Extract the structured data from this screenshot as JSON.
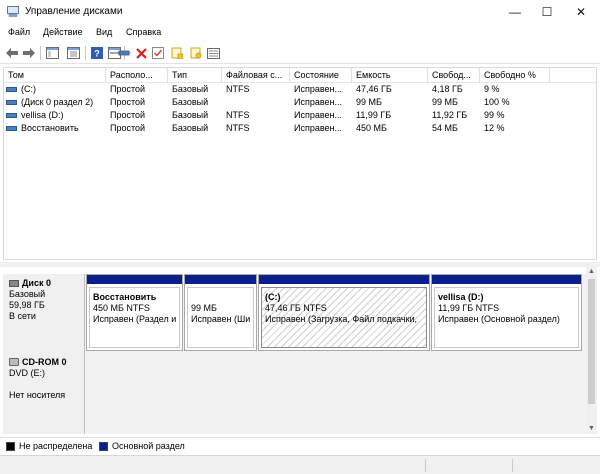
{
  "window": {
    "title": "Управление дисками",
    "minimize": "—",
    "maximize": "☐",
    "close": "✕"
  },
  "menu": [
    "Файл",
    "Действие",
    "Вид",
    "Справка"
  ],
  "toolbar": {
    "buttons": [
      "back-icon",
      "forward-icon",
      "console-tree-icon",
      "help-icon",
      "properties-icon",
      "connect-disk-icon",
      "delete-icon",
      "check-icon",
      "folder-icon",
      "folder-open-icon",
      "view-list-icon"
    ]
  },
  "volumes": {
    "columns": [
      "Том",
      "Располо...",
      "Тип",
      "Файловая с...",
      "Состояние",
      "Емкость",
      "Свобод...",
      "Свободно %"
    ],
    "rows": [
      [
        "(C:)",
        "Простой",
        "Базовый",
        "NTFS",
        "Исправен...",
        "47,46 ГБ",
        "4,18 ГБ",
        "9 %"
      ],
      [
        "(Диск 0 раздел 2)",
        "Простой",
        "Базовый",
        "",
        "Исправен...",
        "99 МБ",
        "99 МБ",
        "100 %"
      ],
      [
        "vellisa (D:)",
        "Простой",
        "Базовый",
        "NTFS",
        "Исправен...",
        "11,99 ГБ",
        "11,92 ГБ",
        "99 %"
      ],
      [
        "Восстановить",
        "Простой",
        "Базовый",
        "NTFS",
        "Исправен...",
        "450 МБ",
        "54 МБ",
        "12 %"
      ]
    ]
  },
  "disks": [
    {
      "name": "Диск 0",
      "type": "Базовый",
      "size": "59,98 ГБ",
      "status": "В сети",
      "partitions": [
        {
          "name": "Восстановить",
          "size": "450 МБ NTFS",
          "status": "Исправен (Раздел и"
        },
        {
          "name": "",
          "size": "99 МБ",
          "status": "Исправен (Ши"
        },
        {
          "name": "(C:)",
          "size": "47,46 ГБ NTFS",
          "status": "Исправен (Загрузка, Файл подкачки,"
        },
        {
          "name": "vellisa  (D:)",
          "size": "11,99 ГБ NTFS",
          "status": "Исправен (Основной раздел)"
        }
      ]
    },
    {
      "name": "CD-ROM 0",
      "type": "DVD (E:)",
      "status": "Нет носителя"
    }
  ],
  "legend": [
    {
      "label": "Не распределена",
      "color": "#000000"
    },
    {
      "label": "Основной раздел",
      "color": "#0b1f8a"
    }
  ],
  "colors": {
    "primary_partition": "#0b1f8a",
    "unallocated": "#000000",
    "volume_icon": "#4a7fc0"
  }
}
